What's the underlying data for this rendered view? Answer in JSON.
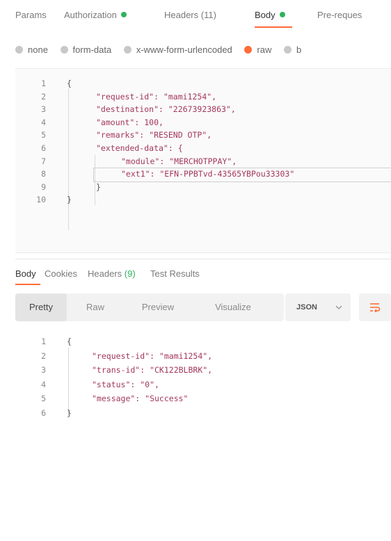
{
  "request_tabs": [
    {
      "label": "Params",
      "dot": null
    },
    {
      "label": "Authorization",
      "dot": "#2fb35c"
    },
    {
      "label": "Headers (11)",
      "dot": null
    },
    {
      "label": "Body",
      "dot": "#2fb35c",
      "active": true
    },
    {
      "label": "Pre-reques",
      "dot": null
    }
  ],
  "body_types": [
    {
      "label": "none",
      "selected": false
    },
    {
      "label": "form-data",
      "selected": false
    },
    {
      "label": "x-www-form-urlencoded",
      "selected": false
    },
    {
      "label": "raw",
      "selected": true
    },
    {
      "label": "b",
      "selected": false
    }
  ],
  "request_body": {
    "line_numbers": [
      "1",
      "2",
      "3",
      "4",
      "5",
      "6",
      "7",
      "8",
      "9",
      "10"
    ],
    "lines": [
      "{",
      "\"request-id\": \"mami1254\",",
      "\"destination\": \"22673923863\",",
      "\"amount\": 100,",
      "\"remarks\": \"RESEND OTP\",",
      "\"extended-data\": {",
      "\"module\": \"MERCHOTPPAY\",",
      "\"ext1\": \"EFN-PPBTvd-43565YBPou33303\"",
      "}",
      "}"
    ]
  },
  "response_tabs": [
    {
      "label": "Body",
      "active": true
    },
    {
      "label": "Cookies"
    },
    {
      "label": "Headers",
      "count": "(9)"
    },
    {
      "label": "Test Results"
    }
  ],
  "response_view_modes": [
    "Pretty",
    "Raw",
    "Preview",
    "Visualize"
  ],
  "response_format": "JSON",
  "response_body": {
    "line_numbers": [
      "1",
      "2",
      "3",
      "4",
      "5",
      "6"
    ],
    "lines": [
      "{",
      "\"request-id\": \"mami1254\",",
      "\"trans-id\": \"CK122BLBRK\",",
      "\"status\": \"0\",",
      "\"message\": \"Success\"",
      "}"
    ]
  },
  "colors": {
    "accent": "#ff6c37",
    "ok_dot": "#2fb35c",
    "json_key": "#a3385a",
    "json_string": "#0d52b7",
    "json_number": "#098658"
  },
  "icons": {
    "format_select_chevron": "chevron-down-icon",
    "wrap_button": "wrap-lines-icon"
  }
}
